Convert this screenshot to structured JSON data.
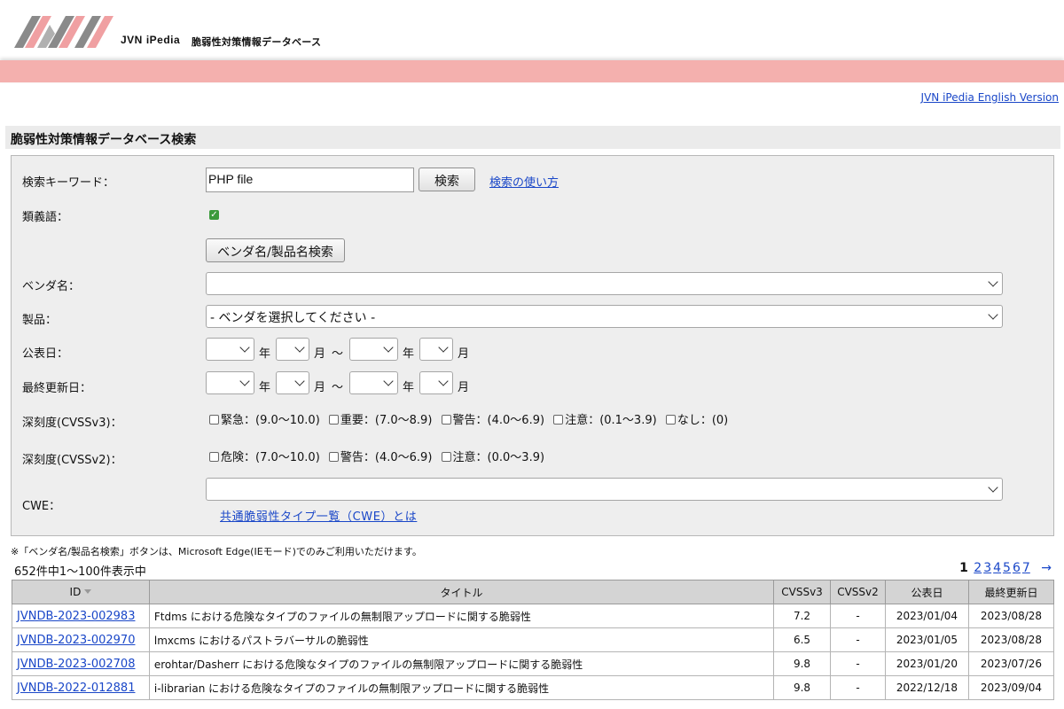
{
  "header": {
    "brand_jvn": "JVN",
    "brand_ipedia": "iPedia",
    "brand_sub": "脆弱性対策情報データベース",
    "colors": {
      "accent_pink": "#f4b0ae",
      "logo_grey": "#8a8a8a",
      "link_blue": "#1a47c8"
    }
  },
  "english_link": "JVN iPedia English Version",
  "section_title": "脆弱性対策情報データベース検索",
  "search": {
    "keyword_label": "検索キーワード：",
    "keyword_value": "PHP file",
    "search_button": "検索",
    "help_link": "検索の使い方",
    "synonym_label": "類義語：",
    "synonym_checked": true,
    "vendor_search_button": "ベンダ名/製品名検索",
    "vendor_label": "ベンダ名：",
    "vendor_value": "",
    "product_label": "製品：",
    "product_value": "- ベンダを選択してください -",
    "published_label": "公表日：",
    "updated_label": "最終更新日：",
    "unit_year": "年",
    "unit_month": "月",
    "range_sep": "〜",
    "cvss3_label": "深刻度(CVSSv3)：",
    "cvss3_options": [
      "緊急：(9.0〜10.0)",
      "重要：(7.0〜8.9)",
      "警告：(4.0〜6.9)",
      "注意：(0.1〜3.9)",
      "なし：(0)"
    ],
    "cvss2_label": "深刻度(CVSSv2)：",
    "cvss2_options": [
      "危険：(7.0〜10.0)",
      "警告：(4.0〜6.9)",
      "注意：(0.0〜3.9)"
    ],
    "cwe_label": "CWE：",
    "cwe_value": "",
    "cwe_link": "共通脆弱性タイプ一覧（CWE）とは"
  },
  "note": "※「ベンダ名/製品名検索」ボタンは、Microsoft Edge(IEモード)でのみご利用いただけます。",
  "result_count": "652件中1〜100件表示中",
  "pager": {
    "current": "1",
    "pages": [
      "2",
      "3",
      "4",
      "5",
      "6",
      "7"
    ],
    "next": "→"
  },
  "table": {
    "headers": [
      "ID",
      "タイトル",
      "CVSSv3",
      "CVSSv2",
      "公表日",
      "最終更新日"
    ],
    "rows": [
      [
        "JVNDB-2023-002983",
        "Ftdms における危険なタイプのファイルの無制限アップロードに関する脆弱性",
        "7.2",
        "-",
        "2023/01/04",
        "2023/08/28"
      ],
      [
        "JVNDB-2023-002970",
        "lmxcms におけるパストラバーサルの脆弱性",
        "6.5",
        "-",
        "2023/01/05",
        "2023/08/28"
      ],
      [
        "JVNDB-2023-002708",
        "erohtar/Dasherr における危険なタイプのファイルの無制限アップロードに関する脆弱性",
        "9.8",
        "-",
        "2023/01/20",
        "2023/07/26"
      ],
      [
        "JVNDB-2022-012881",
        "i-librarian における危険なタイプのファイルの無制限アップロードに関する脆弱性",
        "9.8",
        "-",
        "2022/12/18",
        "2023/09/04"
      ]
    ]
  }
}
